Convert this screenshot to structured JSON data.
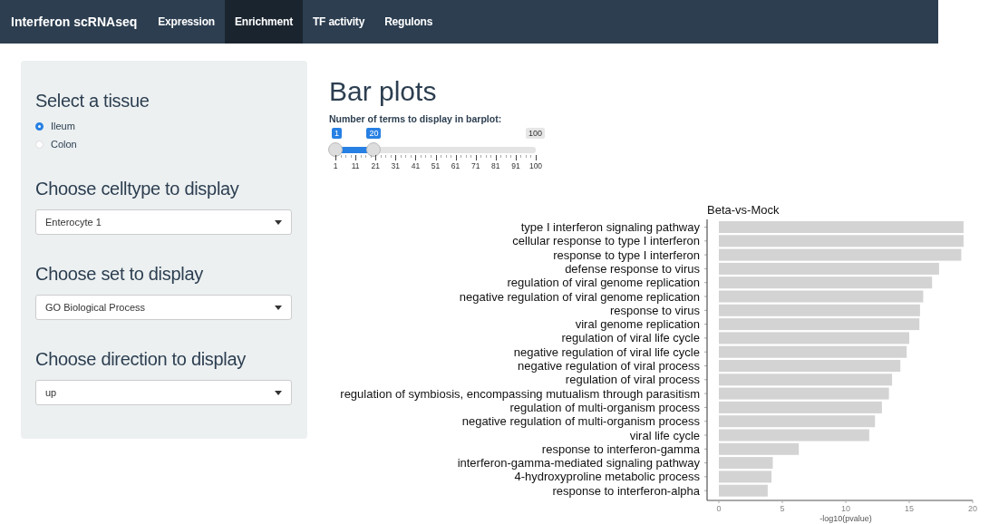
{
  "navbar": {
    "brand": "Interferon scRNAseq",
    "tabs": [
      {
        "label": "Expression",
        "selected": false
      },
      {
        "label": "Enrichment",
        "selected": true
      },
      {
        "label": "TF activity",
        "selected": false
      },
      {
        "label": "Regulons",
        "selected": false
      }
    ]
  },
  "sidebar": {
    "sections": [
      {
        "kind": "radio",
        "heading": "Select a tissue",
        "options": [
          {
            "label": "Ileum",
            "selected": true
          },
          {
            "label": "Colon",
            "selected": false
          }
        ]
      },
      {
        "kind": "select",
        "heading": "Choose celltype to display",
        "value": "Enterocyte 1"
      },
      {
        "kind": "select",
        "heading": "Choose set to display",
        "value": "GO Biological Process"
      },
      {
        "kind": "select",
        "heading": "Choose direction to display",
        "value": "up"
      }
    ]
  },
  "main": {
    "title": "Bar plots",
    "slider": {
      "label": "Number of terms to display in barplot:",
      "max_label": "100",
      "from": {
        "label": "1",
        "level": 0
      },
      "to": {
        "label": "20",
        "level": 0.192
      },
      "ticks": [
        "1",
        "11",
        "21",
        "31",
        "41",
        "51",
        "61",
        "71",
        "81",
        "91",
        "100"
      ]
    },
    "chart_data": {
      "type": "bar",
      "orientation": "horizontal",
      "title": "Beta-vs-Mock",
      "xlabel": "-log10(pvalue)",
      "xlim": [
        0,
        20
      ],
      "xticks": [
        0,
        5,
        10,
        15,
        20
      ],
      "categories": [
        "type I interferon signaling pathway",
        "cellular response to type I interferon",
        "response to type I interferon",
        "defense response to virus",
        "regulation of viral genome replication",
        "negative regulation of viral genome replication",
        "response to virus",
        "viral genome replication",
        "regulation of viral life cycle",
        "negative regulation of viral life cycle",
        "negative regulation of viral process",
        "regulation of viral process",
        "regulation of symbiosis, encompassing mutualism through parasitism",
        "regulation of multi-organism process",
        "negative regulation of multi-organism process",
        "viral life cycle",
        "response to interferon-gamma",
        "interferon-gamma-mediated signaling pathway",
        "4-hydroxyproline metabolic process",
        "response to interferon-alpha"
      ],
      "values": [
        19.28,
        19.28,
        19.1,
        17.35,
        16.8,
        16.1,
        15.85,
        15.8,
        15.0,
        14.8,
        14.3,
        13.65,
        13.4,
        12.85,
        12.3,
        11.85,
        6.3,
        4.25,
        4.15,
        3.85
      ]
    }
  }
}
